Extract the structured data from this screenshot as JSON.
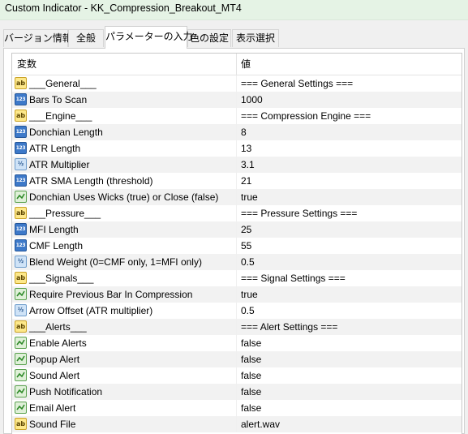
{
  "window": {
    "title": "Custom Indicator - KK_Compression_Breakout_MT4"
  },
  "tabs": [
    {
      "label": "バージョン情報"
    },
    {
      "label": "全般"
    },
    {
      "label": "パラメーターの入力"
    },
    {
      "label": "色の設定"
    },
    {
      "label": "表示選択"
    }
  ],
  "active_tab": "パラメーターの入力",
  "grid": {
    "col_variable": "変数",
    "col_value": "値",
    "rows": [
      {
        "type": "string",
        "icon": "string-type-icon",
        "name": "___General___",
        "value": "=== General Settings ==="
      },
      {
        "type": "int",
        "icon": "integer-type-icon",
        "name": "Bars To Scan",
        "value": "1000"
      },
      {
        "type": "string",
        "icon": "string-type-icon",
        "name": "___Engine___",
        "value": "=== Compression Engine ==="
      },
      {
        "type": "int",
        "icon": "integer-type-icon",
        "name": "Donchian Length",
        "value": "8"
      },
      {
        "type": "int",
        "icon": "integer-type-icon",
        "name": "ATR Length",
        "value": "13"
      },
      {
        "type": "double",
        "icon": "double-type-icon",
        "name": "ATR Multiplier",
        "value": "3.1"
      },
      {
        "type": "int",
        "icon": "integer-type-icon",
        "name": "ATR SMA Length (threshold)",
        "value": "21"
      },
      {
        "type": "bool",
        "icon": "boolean-type-icon",
        "name": "Donchian Uses Wicks (true) or Close (false)",
        "value": "true"
      },
      {
        "type": "string",
        "icon": "string-type-icon",
        "name": "___Pressure___",
        "value": "=== Pressure Settings ==="
      },
      {
        "type": "int",
        "icon": "integer-type-icon",
        "name": "MFI Length",
        "value": "25"
      },
      {
        "type": "int",
        "icon": "integer-type-icon",
        "name": "CMF Length",
        "value": "55"
      },
      {
        "type": "double",
        "icon": "double-type-icon",
        "name": "Blend Weight (0=CMF only, 1=MFI only)",
        "value": "0.5"
      },
      {
        "type": "string",
        "icon": "string-type-icon",
        "name": "___Signals___",
        "value": "=== Signal Settings ==="
      },
      {
        "type": "bool",
        "icon": "boolean-type-icon",
        "name": "Require Previous Bar In Compression",
        "value": "true"
      },
      {
        "type": "double",
        "icon": "double-type-icon",
        "name": "Arrow Offset (ATR multiplier)",
        "value": "0.5"
      },
      {
        "type": "string",
        "icon": "string-type-icon",
        "name": "___Alerts___",
        "value": "=== Alert Settings ==="
      },
      {
        "type": "bool",
        "icon": "boolean-type-icon",
        "name": "Enable Alerts",
        "value": "false"
      },
      {
        "type": "bool",
        "icon": "boolean-type-icon",
        "name": "Popup Alert",
        "value": "false"
      },
      {
        "type": "bool",
        "icon": "boolean-type-icon",
        "name": "Sound Alert",
        "value": "false"
      },
      {
        "type": "bool",
        "icon": "boolean-type-icon",
        "name": "Push Notification",
        "value": "false"
      },
      {
        "type": "bool",
        "icon": "boolean-type-icon",
        "name": "Email Alert",
        "value": "false"
      },
      {
        "type": "string",
        "icon": "string-type-icon",
        "name": "Sound File",
        "value": "alert.wav"
      }
    ]
  },
  "icon_labels": {
    "string": "ab",
    "int": "123",
    "double": "½"
  },
  "colors": {
    "titlebar_bg": "#e5f3e5",
    "row_alt_bg": "#f2f2f2"
  }
}
